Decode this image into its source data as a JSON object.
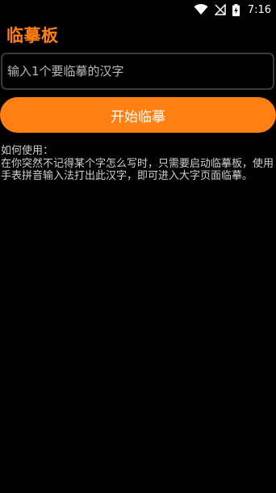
{
  "status_bar": {
    "time": "7:16",
    "icons": [
      "wifi-icon",
      "cellular-no-signal-icon",
      "battery-charging-icon"
    ]
  },
  "app": {
    "title": "临摹板"
  },
  "input": {
    "value": "",
    "placeholder": "输入1个要临摹的汉字"
  },
  "start_button": {
    "label": "开始临摹"
  },
  "help": {
    "heading": "如何使用：",
    "body": "在你突然不记得某个字怎么写时，只需要启动临摹板，使用手表拼音输入法打出此汉字，即可进入大字页面临摹。"
  },
  "colors": {
    "accent": "#ff7f12",
    "background": "#000000",
    "text": "#ffffff",
    "muted_text": "#d0d0d0",
    "border": "#3a3a3a"
  }
}
